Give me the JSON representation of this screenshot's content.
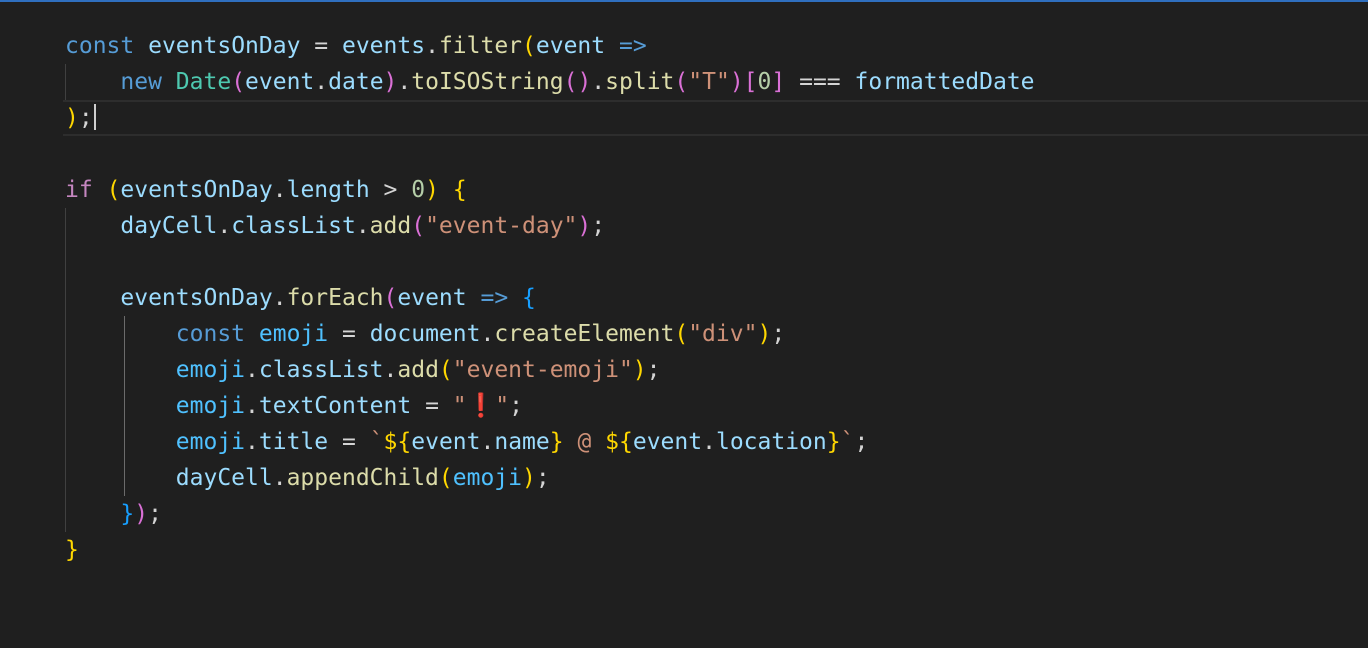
{
  "editor": {
    "language": "javascript",
    "theme_colors": {
      "background": "#1f1f1f",
      "keyword": "#569cd6",
      "control": "#c586c0",
      "variable": "#9cdcfe",
      "constant": "#4fc1ff",
      "function": "#dcdcaa",
      "class": "#4ec9b0",
      "string": "#ce9178",
      "number": "#b5cea8",
      "bracket_level_1": "#ffd700",
      "bracket_level_2": "#da70d6",
      "bracket_level_3": "#179fff"
    },
    "current_line": 3,
    "lines": [
      "const eventsOnDay = events.filter(event =>",
      "    new Date(event.date).toISOString().split(\"T\")[0] === formattedDate",
      ");",
      "",
      "if (eventsOnDay.length > 0) {",
      "    dayCell.classList.add(\"event-day\");",
      "",
      "    eventsOnDay.forEach(event => {",
      "        const emoji = document.createElement(\"div\");",
      "        emoji.classList.add(\"event-emoji\");",
      "        emoji.textContent = \"❗\";",
      "        emoji.title = `${event.name} @ ${event.location}`;",
      "        dayCell.appendChild(emoji);",
      "    });",
      "}"
    ]
  },
  "t": {
    "l1_const": "const",
    "l1_eventsOnDay": "eventsOnDay",
    "l1_eq": " = ",
    "l1_events": "events",
    "l1_dot": ".",
    "l1_filter": "filter",
    "l1_paren": "(",
    "l1_event": "event",
    "l1_arrow": " =>",
    "l2_new": "new",
    "l2_Date": "Date",
    "l2_p1": "(",
    "l2_event": "event",
    "l2_dot1": ".",
    "l2_date": "date",
    "l2_p1c": ")",
    "l2_dot2": ".",
    "l2_toISOString": "toISOString",
    "l2_p2": "()",
    "l2_dot3": ".",
    "l2_split": "split",
    "l2_p3": "(",
    "l2_T": "\"T\"",
    "l2_p3c": ")",
    "l2_b1": "[",
    "l2_zero": "0",
    "l2_b1c": "]",
    "l2_eqeq": " === ",
    "l2_formattedDate": "formattedDate",
    "l3_paren": ")",
    "l3_semi": ";",
    "l5_if": "if",
    "l5_p": "(",
    "l5_eventsOnDay": "eventsOnDay",
    "l5_dot": ".",
    "l5_length": "length",
    "l5_gt": " > ",
    "l5_zero": "0",
    "l5_pc": ")",
    "l5_brace": "{",
    "l6_dayCell": "dayCell",
    "l6_dot1": ".",
    "l6_classList": "classList",
    "l6_dot2": ".",
    "l6_add": "add",
    "l6_p": "(",
    "l6_str": "\"event-day\"",
    "l6_pc": ")",
    "l6_semi": ";",
    "l8_eventsOnDay": "eventsOnDay",
    "l8_dot": ".",
    "l8_forEach": "forEach",
    "l8_p": "(",
    "l8_event": "event",
    "l8_arrow": "=>",
    "l8_brace": "{",
    "l9_const": "const",
    "l9_emoji": "emoji",
    "l9_eq": " = ",
    "l9_document": "document",
    "l9_dot": ".",
    "l9_createElement": "createElement",
    "l9_p": "(",
    "l9_str": "\"div\"",
    "l9_pc": ")",
    "l9_semi": ";",
    "l10_emoji": "emoji",
    "l10_dot1": ".",
    "l10_classList": "classList",
    "l10_dot2": ".",
    "l10_add": "add",
    "l10_p": "(",
    "l10_str": "\"event-emoji\"",
    "l10_pc": ")",
    "l10_semi": ";",
    "l11_emoji": "emoji",
    "l11_dot": ".",
    "l11_textContent": "textContent",
    "l11_eq": " = ",
    "l11_q1": "\"",
    "l11_excl": "❗",
    "l11_q2": "\"",
    "l11_semi": ";",
    "l12_emoji": "emoji",
    "l12_dot": ".",
    "l12_title": "title",
    "l12_eq": " = ",
    "l12_bt": "`",
    "l12_d1": "${",
    "l12_event1": "event",
    "l12_dotA": ".",
    "l12_name": "name",
    "l12_c1": "}",
    "l12_at": " @ ",
    "l12_d2": "${",
    "l12_event2": "event",
    "l12_dotB": ".",
    "l12_location": "location",
    "l12_c2": "}",
    "l12_bt2": "`",
    "l12_semi": ";",
    "l13_dayCell": "dayCell",
    "l13_dot": ".",
    "l13_appendChild": "appendChild",
    "l13_p": "(",
    "l13_emoji": "emoji",
    "l13_pc": ")",
    "l13_semi": ";",
    "l14_brace": "}",
    "l14_paren": ")",
    "l14_semi": ";",
    "l15_brace": "}"
  }
}
